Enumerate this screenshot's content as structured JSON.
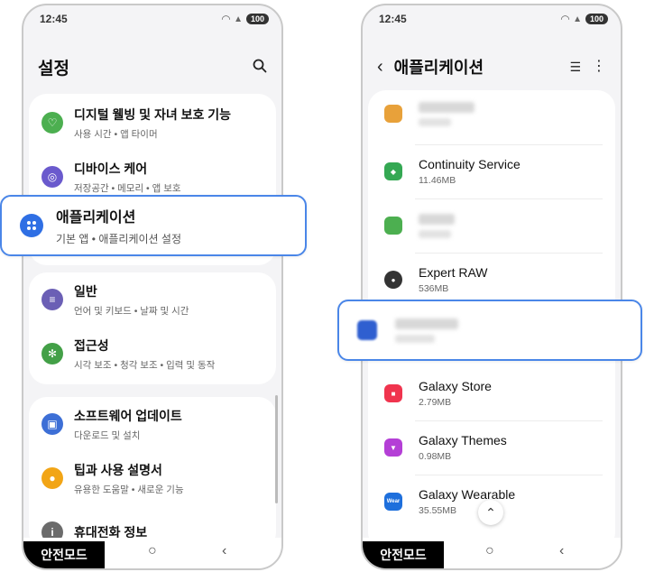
{
  "status": {
    "time": "12:45",
    "battery": "100"
  },
  "left": {
    "title": "설정",
    "card1": [
      {
        "title": "디지털 웰빙 및 자녀 보호 기능",
        "subtitle": "사용 시간 • 앱 타이머",
        "icon": "wellbeing-icon",
        "color": "#4caf50"
      },
      {
        "title": "디바이스 케어",
        "subtitle": "저장공간 • 메모리 • 앱 보호",
        "icon": "device-care-icon",
        "color": "#6a5acd"
      }
    ],
    "highlighted": {
      "title": "애플리케이션",
      "subtitle": "기본 앱 • 애플리케이션 설정",
      "icon": "apps-icon",
      "color": "#2f6fe4"
    },
    "card2": [
      {
        "title": "일반",
        "subtitle": "언어 및 키보드 • 날짜 및 시간",
        "icon": "general-icon",
        "color": "#6b5fb5"
      },
      {
        "title": "접근성",
        "subtitle": "시각 보조 • 청각 보조 • 입력 및 동작",
        "icon": "accessibility-icon",
        "color": "#43a047"
      }
    ],
    "card3": [
      {
        "title": "소프트웨어 업데이트",
        "subtitle": "다운로드 및 설치",
        "icon": "software-update-icon",
        "color": "#3d6fd6"
      },
      {
        "title": "팁과 사용 설명서",
        "subtitle": "유용한 도움말 • 새로운 기능",
        "icon": "tips-icon",
        "color": "#f2a516"
      },
      {
        "title": "휴대전화 정보",
        "subtitle": "",
        "icon": "phone-info-icon",
        "color": "#6b6b6b"
      }
    ],
    "safe_mode": "안전모드"
  },
  "right": {
    "title": "애플리케이션",
    "apps": [
      {
        "name": "",
        "size": "",
        "icon": "blurred-app-icon",
        "color": "#e8a13a",
        "blurred": true
      },
      {
        "name": "Continuity Service",
        "size": "11.46MB",
        "icon": "continuity-service-icon",
        "color": "#34a853",
        "blurred": false
      },
      {
        "name": "",
        "size": "",
        "icon": "blurred-app-icon",
        "color": "#4caf50",
        "blurred": true
      }
    ],
    "apps2": [
      {
        "name": "Expert RAW",
        "size": "536MB",
        "icon": "expert-raw-icon",
        "color": "#333333",
        "blurred": false
      }
    ],
    "apps3": [
      {
        "name": "Galaxy Store",
        "size": "2.79MB",
        "icon": "galaxy-store-icon",
        "color": "#f0344e",
        "blurred": false
      },
      {
        "name": "Galaxy Themes",
        "size": "0.98MB",
        "icon": "galaxy-themes-icon",
        "color": "#b43fd6",
        "blurred": false
      },
      {
        "name": "Galaxy Wearable",
        "size": "35.55MB",
        "icon": "galaxy-wearable-icon",
        "color": "#1e6fdc",
        "blurred": false
      }
    ],
    "wear_label": "Wear",
    "safe_mode": "안전모드"
  }
}
